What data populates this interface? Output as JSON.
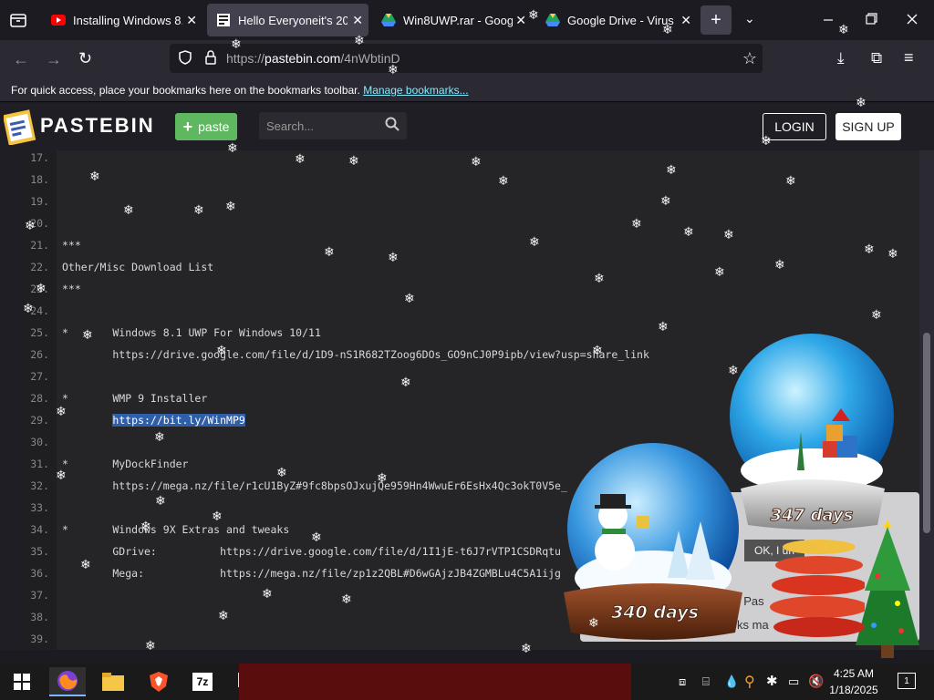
{
  "tabs": [
    {
      "title": "Installing Windows 8.1",
      "icon": "youtube-icon",
      "active": false
    },
    {
      "title": "Hello Everyoneit's 2013",
      "icon": "pastebin-icon",
      "active": true
    },
    {
      "title": "Win8UWP.rar - Google",
      "icon": "google-drive-icon",
      "active": false
    },
    {
      "title": "Google Drive - Virus sc",
      "icon": "google-drive-icon",
      "active": false
    }
  ],
  "url": {
    "prefix": "https://",
    "host": "pastebin.com",
    "path": "/4nWbtinD"
  },
  "bookmarks": {
    "message": "For quick access, place your bookmarks here on the bookmarks toolbar.",
    "link": "Manage bookmarks..."
  },
  "site": {
    "logo_text": "PASTEBIN",
    "paste_label": "paste",
    "search_placeholder": "Search...",
    "login_label": "LOGIN",
    "signup_label": "SIGN UP"
  },
  "code_lines": [
    {
      "n": "17.",
      "text": ""
    },
    {
      "n": "18.",
      "text": ""
    },
    {
      "n": "19.",
      "text": ""
    },
    {
      "n": "20.",
      "text": ""
    },
    {
      "n": "21.",
      "text": "***"
    },
    {
      "n": "22.",
      "text": "Other/Misc Download List"
    },
    {
      "n": "23.",
      "text": "***"
    },
    {
      "n": "24.",
      "text": ""
    },
    {
      "n": "25.",
      "text": "*       Windows 8.1 UWP For Windows 10/11"
    },
    {
      "n": "26.",
      "text": "        https://drive.google.com/file/d/1D9-nS1R682TZoog6DOs_GO9nCJ0P9ipb/view?usp=share_link"
    },
    {
      "n": "27.",
      "text": ""
    },
    {
      "n": "28.",
      "text": "*       WMP 9 Installer"
    },
    {
      "n": "29.",
      "text": "        ",
      "highlight": "https://bit.ly/WinMP9"
    },
    {
      "n": "30.",
      "text": ""
    },
    {
      "n": "31.",
      "text": "*       MyDockFinder"
    },
    {
      "n": "32.",
      "text": "        https://mega.nz/file/r1cU1ByZ#9fc8bpsOJxujQe959Hn4WwuEr6EsHx4Qc3okT0V5e_"
    },
    {
      "n": "33.",
      "text": ""
    },
    {
      "n": "34.",
      "text": "*       Windows 9X Extras and tweaks"
    },
    {
      "n": "35.",
      "text": "        GDrive:          https://drive.google.com/file/d/1I1jE-t6J7rVTP1CSDRqtu"
    },
    {
      "n": "36.",
      "text": "        Mega:            https://mega.nz/file/zp1z2QBL#D6wGAjzJB4ZGMBLu4C5A1ijg"
    },
    {
      "n": "37.",
      "text": ""
    },
    {
      "n": "38.",
      "text": ""
    },
    {
      "n": "39.",
      "text": ""
    }
  ],
  "overlay": {
    "globe1_days": "340 days",
    "globe2_days": "347 days",
    "popup_ok": "OK, I un",
    "popup_frag1": "f Pas",
    "popup_frag2": "ks ma"
  },
  "clock": {
    "time": "4:25 AM",
    "date": "1/18/2025"
  },
  "notification_count": "1"
}
